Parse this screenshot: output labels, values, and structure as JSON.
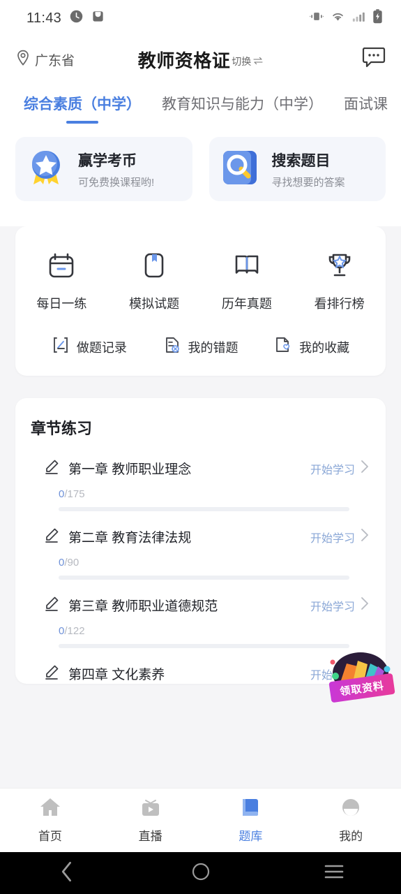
{
  "statusbar": {
    "time": "11:43",
    "left_icons": [
      "clock-badge-icon",
      "inbox-icon"
    ],
    "right_icons": [
      "vibrate-icon",
      "wifi-icon",
      "signal-icon",
      "battery-charging-icon"
    ]
  },
  "header": {
    "location": "广东省",
    "location_icon": "location-pin-icon",
    "title": "教师资格证",
    "switch_label": "切换",
    "switch_icon": "swap-icon",
    "message_icon": "message-icon"
  },
  "tabs": [
    {
      "label": "综合素质（中学）",
      "active": true
    },
    {
      "label": "教育知识与能力（中学）",
      "active": false
    },
    {
      "label": "面试课",
      "active": false
    }
  ],
  "banners": [
    {
      "title": "赢学考币",
      "subtitle": "可免费换课程哟!",
      "icon": "medal-star-icon"
    },
    {
      "title": "搜索题目",
      "subtitle": "寻找想要的答案",
      "icon": "search-square-icon"
    }
  ],
  "quick_grid": [
    {
      "label": "每日一练",
      "icon": "calendar-icon"
    },
    {
      "label": "模拟试题",
      "icon": "bookmark-book-icon"
    },
    {
      "label": "历年真题",
      "icon": "open-book-icon"
    },
    {
      "label": "看排行榜",
      "icon": "trophy-icon"
    }
  ],
  "quick_mini": [
    {
      "label": "做题记录",
      "icon": "note-record-icon"
    },
    {
      "label": "我的错题",
      "icon": "file-error-icon"
    },
    {
      "label": "我的收藏",
      "icon": "file-heart-icon"
    }
  ],
  "chapters": {
    "heading": "章节练习",
    "action_label": "开始学习",
    "rows": [
      {
        "title": "第一章  教师职业理念",
        "done": "0",
        "total": "/175",
        "progress_pct": 0
      },
      {
        "title": "第二章  教育法律法规",
        "done": "0",
        "total": "/90",
        "progress_pct": 0
      },
      {
        "title": "第三章  教师职业道德规范",
        "done": "0",
        "total": "/122",
        "progress_pct": 0
      },
      {
        "title": "第四章  文化素养",
        "done": "",
        "total": "",
        "progress_pct": 0
      }
    ]
  },
  "sticker": {
    "label": "领取资料",
    "icon": "gift-books-icon"
  },
  "bottom_nav": [
    {
      "label": "首页",
      "icon": "home-icon",
      "active": false
    },
    {
      "label": "直播",
      "icon": "live-tv-icon",
      "active": false
    },
    {
      "label": "题库",
      "icon": "book-icon",
      "active": true
    },
    {
      "label": "我的",
      "icon": "profile-icon",
      "active": false
    }
  ],
  "system_bar": [
    {
      "name": "back-icon"
    },
    {
      "name": "home-circle-icon"
    },
    {
      "name": "recents-icon"
    }
  ],
  "colors": {
    "accent": "#4a7fe0",
    "accent_light": "#8aa7d6",
    "page_bg": "#f5f5f7",
    "card_bg": "#ffffff",
    "banner_bg": "#f4f6fb",
    "text_primary": "#23252b",
    "text_secondary": "#8b8e96",
    "progress_track": "#eef0f4"
  }
}
